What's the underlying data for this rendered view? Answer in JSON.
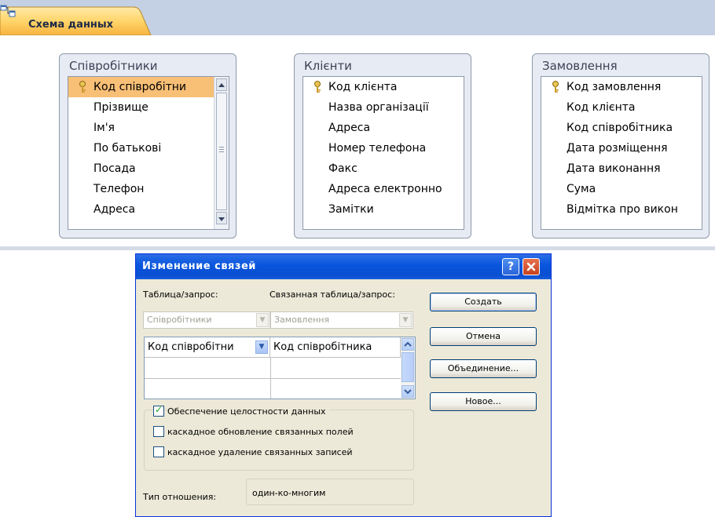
{
  "tab": {
    "label": "Схема данных"
  },
  "tables": [
    {
      "title": "Співробітники",
      "fields": [
        {
          "name": "Код співробітни",
          "key": true,
          "selected": true
        },
        {
          "name": "Прізвище",
          "key": false
        },
        {
          "name": "Ім'я",
          "key": false
        },
        {
          "name": "По батькові",
          "key": false
        },
        {
          "name": "Посада",
          "key": false
        },
        {
          "name": "Телефон",
          "key": false
        },
        {
          "name": "Адреса",
          "key": false
        }
      ]
    },
    {
      "title": "Клієнти",
      "fields": [
        {
          "name": "Код клієнта",
          "key": true
        },
        {
          "name": "Назва організації",
          "key": false
        },
        {
          "name": "Адреса",
          "key": false
        },
        {
          "name": "Номер телефона",
          "key": false
        },
        {
          "name": "Факс",
          "key": false
        },
        {
          "name": "Адреса електронно",
          "key": false
        },
        {
          "name": "Замітки",
          "key": false
        }
      ]
    },
    {
      "title": "Замовлення",
      "fields": [
        {
          "name": "Код замовлення",
          "key": true
        },
        {
          "name": "Код клієнта",
          "key": false
        },
        {
          "name": "Код співробітника",
          "key": false
        },
        {
          "name": "Дата розміщення",
          "key": false
        },
        {
          "name": "Дата виконання",
          "key": false
        },
        {
          "name": "Сума",
          "key": false
        },
        {
          "name": "Відмітка про викон",
          "key": false
        }
      ]
    }
  ],
  "dialog": {
    "title": "Изменение связей",
    "table_label": "Таблица/запрос:",
    "related_label": "Связанная таблица/запрос:",
    "table_value": "Співробітники",
    "related_value": "Замовлення",
    "grid": {
      "left_field": "Код співробітни",
      "right_field": "Код співробітника"
    },
    "buttons": {
      "create": "Создать",
      "cancel": "Отмена",
      "join": "Объединение...",
      "new": "Новое..."
    },
    "checkboxes": [
      {
        "label": "Обеспечение целостности данных",
        "checked": true
      },
      {
        "label": "каскадное обновление связанных полей",
        "checked": false
      },
      {
        "label": "каскадное удаление связанных записей",
        "checked": false
      }
    ],
    "relation_type_label": "Тип отношения:",
    "relation_type_value": "один-ко-многим"
  }
}
